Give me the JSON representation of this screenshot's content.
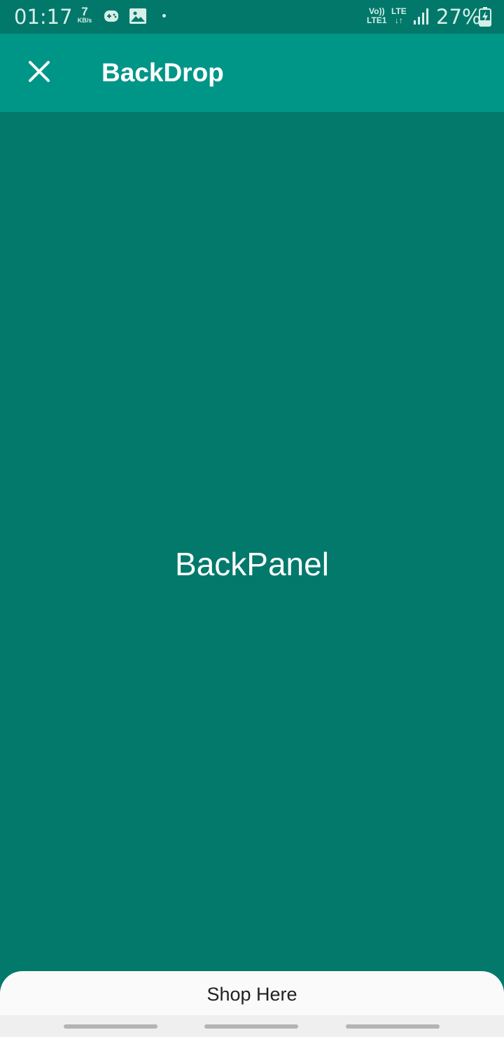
{
  "status_bar": {
    "time": "01:17",
    "net_speed_value": "7",
    "net_speed_unit": "KB/s",
    "notification_icons": [
      "game-controller-icon",
      "image-icon",
      "dot-icon"
    ],
    "volte_line1": "Vo))",
    "volte_line2": "LTE1",
    "lte_label": "LTE",
    "data_arrows": "↓↑",
    "battery_percent": "27%"
  },
  "app_bar": {
    "title": "BackDrop",
    "close_icon": "close-icon"
  },
  "back_panel": {
    "label": "BackPanel"
  },
  "front_panel": {
    "label": "Shop Here"
  },
  "colors": {
    "status_bar": "#01786a",
    "app_bar": "#009687",
    "back_panel": "#02796b",
    "front_panel": "#fafafa"
  }
}
